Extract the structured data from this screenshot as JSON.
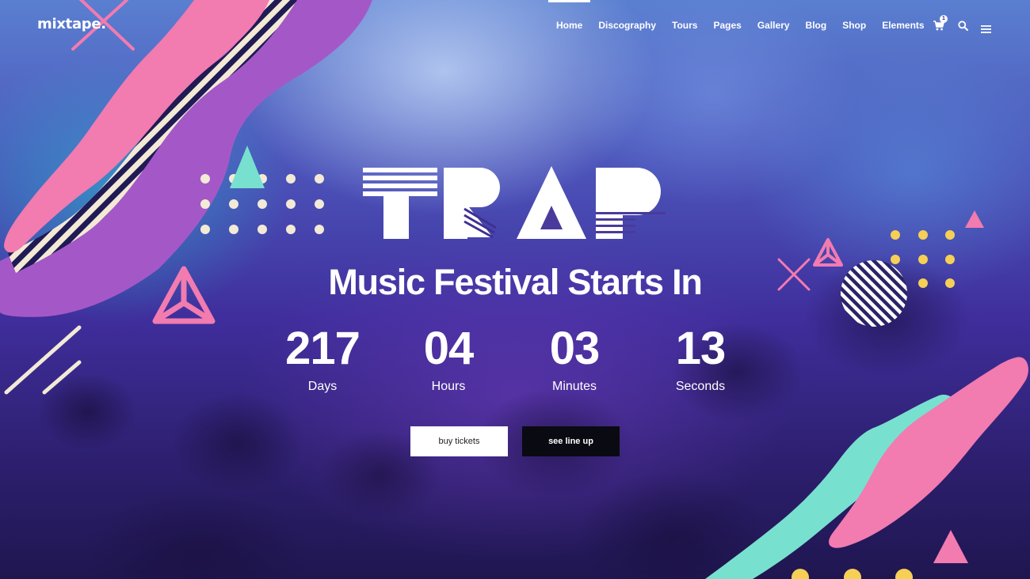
{
  "site": {
    "logo": "mixtape."
  },
  "nav": {
    "items": [
      "Home",
      "Discography",
      "Tours",
      "Pages",
      "Gallery",
      "Blog",
      "Shop",
      "Elements"
    ],
    "active": "Home",
    "cart_count": "1",
    "icons": [
      "cart-icon",
      "search-icon",
      "menu-icon"
    ]
  },
  "hero": {
    "logo_text": "TRAP",
    "headline": "Music Festival Starts In",
    "countdown": [
      {
        "value": "217",
        "label": "Days"
      },
      {
        "value": "04",
        "label": "Hours"
      },
      {
        "value": "03",
        "label": "Minutes"
      },
      {
        "value": "13",
        "label": "Seconds"
      }
    ],
    "buttons": {
      "primary": "buy tickets",
      "secondary": "see line up"
    }
  },
  "colors": {
    "pink": "#f27bb0",
    "purple": "#a458c7",
    "mint": "#78e0cf",
    "cream": "#f3ead6",
    "yellow": "#f6cf55",
    "white": "#ffffff",
    "dark": "#0a0a12"
  }
}
